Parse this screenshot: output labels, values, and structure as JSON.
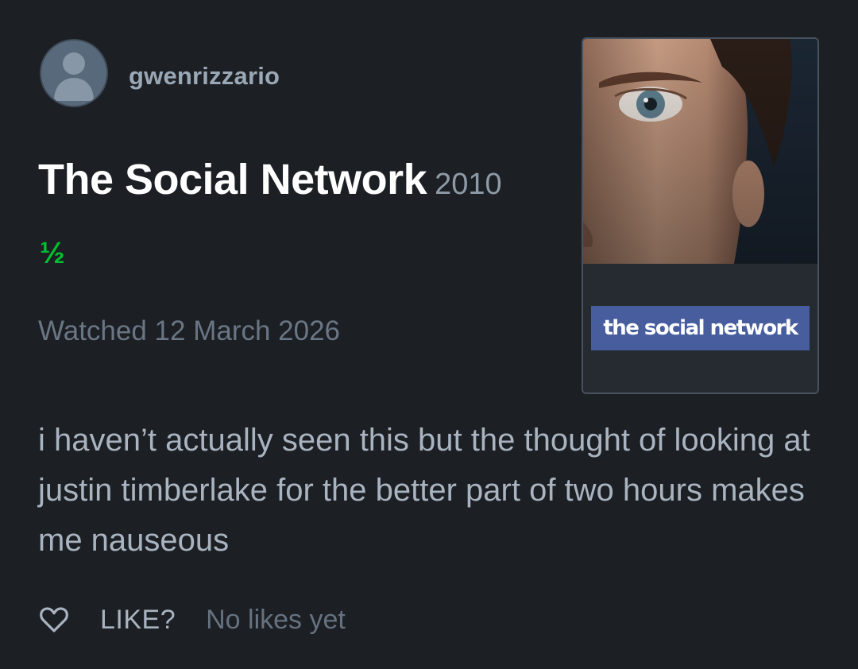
{
  "user": {
    "username": "gwenrizzario",
    "avatar_icon": "default-user-avatar-icon"
  },
  "film": {
    "title": "The Social Network",
    "year": "2010",
    "poster_title_text": "the social network"
  },
  "review": {
    "rating_display": "½",
    "rating_stars": 0.5,
    "rating_color": "#00c030",
    "watched_text": "Watched 12 March 2026",
    "body": "i haven’t actually seen this but the thought of looking at justin timberlake for the better part of two hours makes me nauseous"
  },
  "actions": {
    "like_icon": "heart-outline-icon",
    "like_label": "LIKE?",
    "likes_status": "No likes yet"
  },
  "colors": {
    "background": "#1c1f24",
    "title": "#ffffff",
    "muted": "#6a7684",
    "body_text": "#a9b4c0",
    "rating_green": "#00c030"
  }
}
